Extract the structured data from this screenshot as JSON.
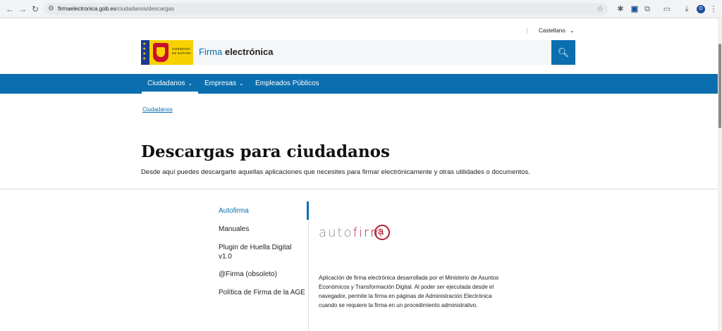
{
  "browser": {
    "url_host": "firmaelectronica.gob.es",
    "url_path": "/ciudadanos/descargas",
    "profile_initial": "O"
  },
  "header": {
    "language": "Castellano",
    "gov_logo_text": [
      "GOBIERNO",
      "DE ESPAÑA"
    ],
    "site_title_part1": "Firma",
    "site_title_part2": "electrónica",
    "search_icon": "search-icon"
  },
  "nav": {
    "items": [
      {
        "label": "Ciudadanos",
        "active": true,
        "dropdown": true
      },
      {
        "label": "Empresas",
        "active": false,
        "dropdown": true
      },
      {
        "label": "Empleados Públicos",
        "active": false,
        "dropdown": false
      }
    ]
  },
  "breadcrumb": "Ciudadanos",
  "main": {
    "title": "Descargas para ciudadanos",
    "description": "Desde aquí puedes descargarte aquellas aplicaciones que necesites para firmar electrónicamente y otras utilidades o documentos."
  },
  "side_menu": {
    "items": [
      {
        "label": "Autofirma",
        "active": true
      },
      {
        "label": "Manuales",
        "active": false
      },
      {
        "label": "Plugin de Huella Digital v1.0",
        "active": false
      },
      {
        "label": "@Firma (obsoleto)",
        "active": false
      },
      {
        "label": "Política de Firma de la AGE",
        "active": false
      }
    ]
  },
  "content": {
    "logo_text_gray": "auto",
    "logo_text_red": "firm",
    "description": "Aplicación de firma electrónica desarrollada por el Ministerio de Asuntos Económicos y Transformación Digital. Al poder ser ejecutada desde el navegador, permite la firma en páginas de Administración Electrónica cuando se requiere la firma en un procedimiento administrativo."
  },
  "colors": {
    "brand_blue": "#0b6eaf",
    "autofirma_red": "#b0203a"
  }
}
